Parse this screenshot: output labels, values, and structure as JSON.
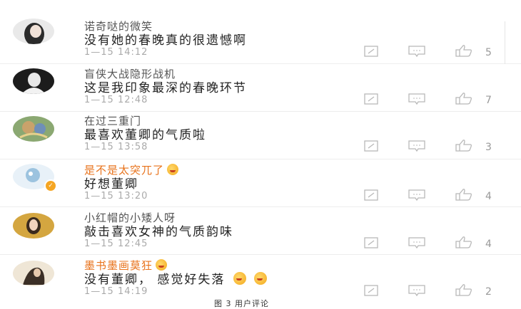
{
  "comments": [
    {
      "user": "诺奇哒的微笑",
      "text": "没有她的春晚真的很遗憾啊",
      "time": "1—15 14:12",
      "likes": "5",
      "vip": false
    },
    {
      "user": "盲侠大战隐形战机",
      "text": "这是我印象最深的春晚环节",
      "time": "1—15 12:48",
      "likes": "7",
      "vip": false
    },
    {
      "user": "在过三重门",
      "text": "最喜欢董卿的气质啦",
      "time": "1—15 13:58",
      "likes": "3",
      "vip": false
    },
    {
      "user": "是不是太突兀了",
      "text": "好想董卿",
      "time": "1—15 13:20",
      "likes": "4",
      "vip": true
    },
    {
      "user": "小红帽的小矮人呀",
      "text": "敲击喜欢女神的气质韵味",
      "time": "1—15 12:45",
      "likes": "4",
      "vip": false
    },
    {
      "user": "墨书墨画莫狂",
      "text": "没有董卿，  感觉好失落",
      "time": "1—15 14:19",
      "likes": "2",
      "vip": true
    }
  ],
  "icons": {
    "comment": "comment-icon",
    "reply": "reply-icon",
    "like": "thumbs-up-icon",
    "vip_emoji": "emoji-icon",
    "verified": "verified-badge-icon"
  },
  "colors": {
    "vip_name": "#e8731c",
    "default_name": "#555555",
    "comment_text": "#222222",
    "meta": "#aaaaaa",
    "icon": "#b8b8b8"
  },
  "caption": "图 3 用户评论"
}
